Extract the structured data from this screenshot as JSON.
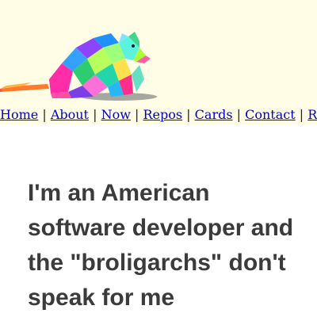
{
  "header": {
    "logo_icon": "rainbow-rat-logo-icon",
    "background_color": "#fffde6"
  },
  "nav": {
    "items": [
      {
        "label": "Home"
      },
      {
        "label": "About"
      },
      {
        "label": "Now"
      },
      {
        "label": "Repos"
      },
      {
        "label": "Cards"
      },
      {
        "label": "Contact"
      },
      {
        "label": "RSS",
        "icon": "rss-icon"
      }
    ],
    "separator": "|",
    "link_color": "#0000cc",
    "rss_icon_color": "#f26522"
  },
  "main": {
    "headline": "I'm an American software developer and the \"broligarchs\" don't speak for me",
    "headline_color": "#3b3b3b"
  }
}
